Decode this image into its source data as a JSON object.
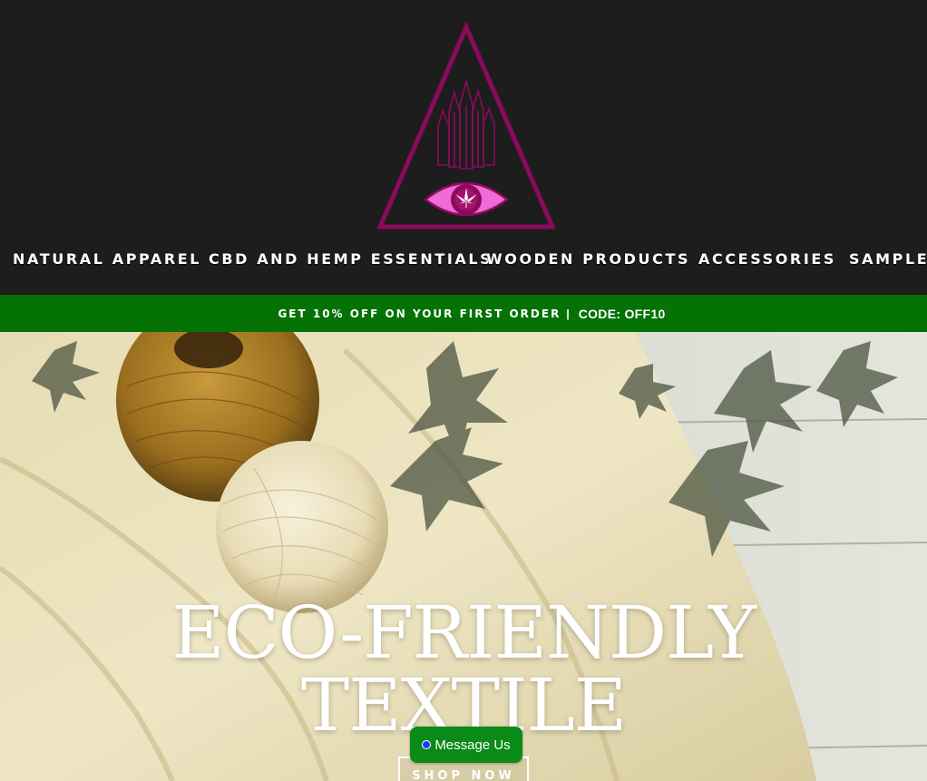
{
  "header": {
    "logo_icon": "triangle-eye-crystal-hemp-logo",
    "colors": {
      "background": "#1d1d1d",
      "logo_magenta": "#8a0b5c",
      "logo_pink": "#f06ad8"
    }
  },
  "nav": {
    "items": [
      {
        "label": "NATURAL APPAREL"
      },
      {
        "label": "CBD AND HEMP ESSENTIALS"
      },
      {
        "label": "WOODEN PRODUCTS"
      },
      {
        "label": "ACCESSORIES"
      },
      {
        "label": "SAMPLE P"
      }
    ]
  },
  "promo": {
    "text": "GET 10% OFF ON YOUR FIRST ORDER",
    "separator": "|",
    "code": "CODE: OFF10",
    "color": "#047204"
  },
  "hero": {
    "title_line1": "ECO-FRIENDLY",
    "title_line2": "TEXTILE",
    "button_label": "SHOP NOW"
  },
  "chat": {
    "label": "Message Us",
    "icon": "status-dot-icon",
    "color": "#0a8a16"
  }
}
